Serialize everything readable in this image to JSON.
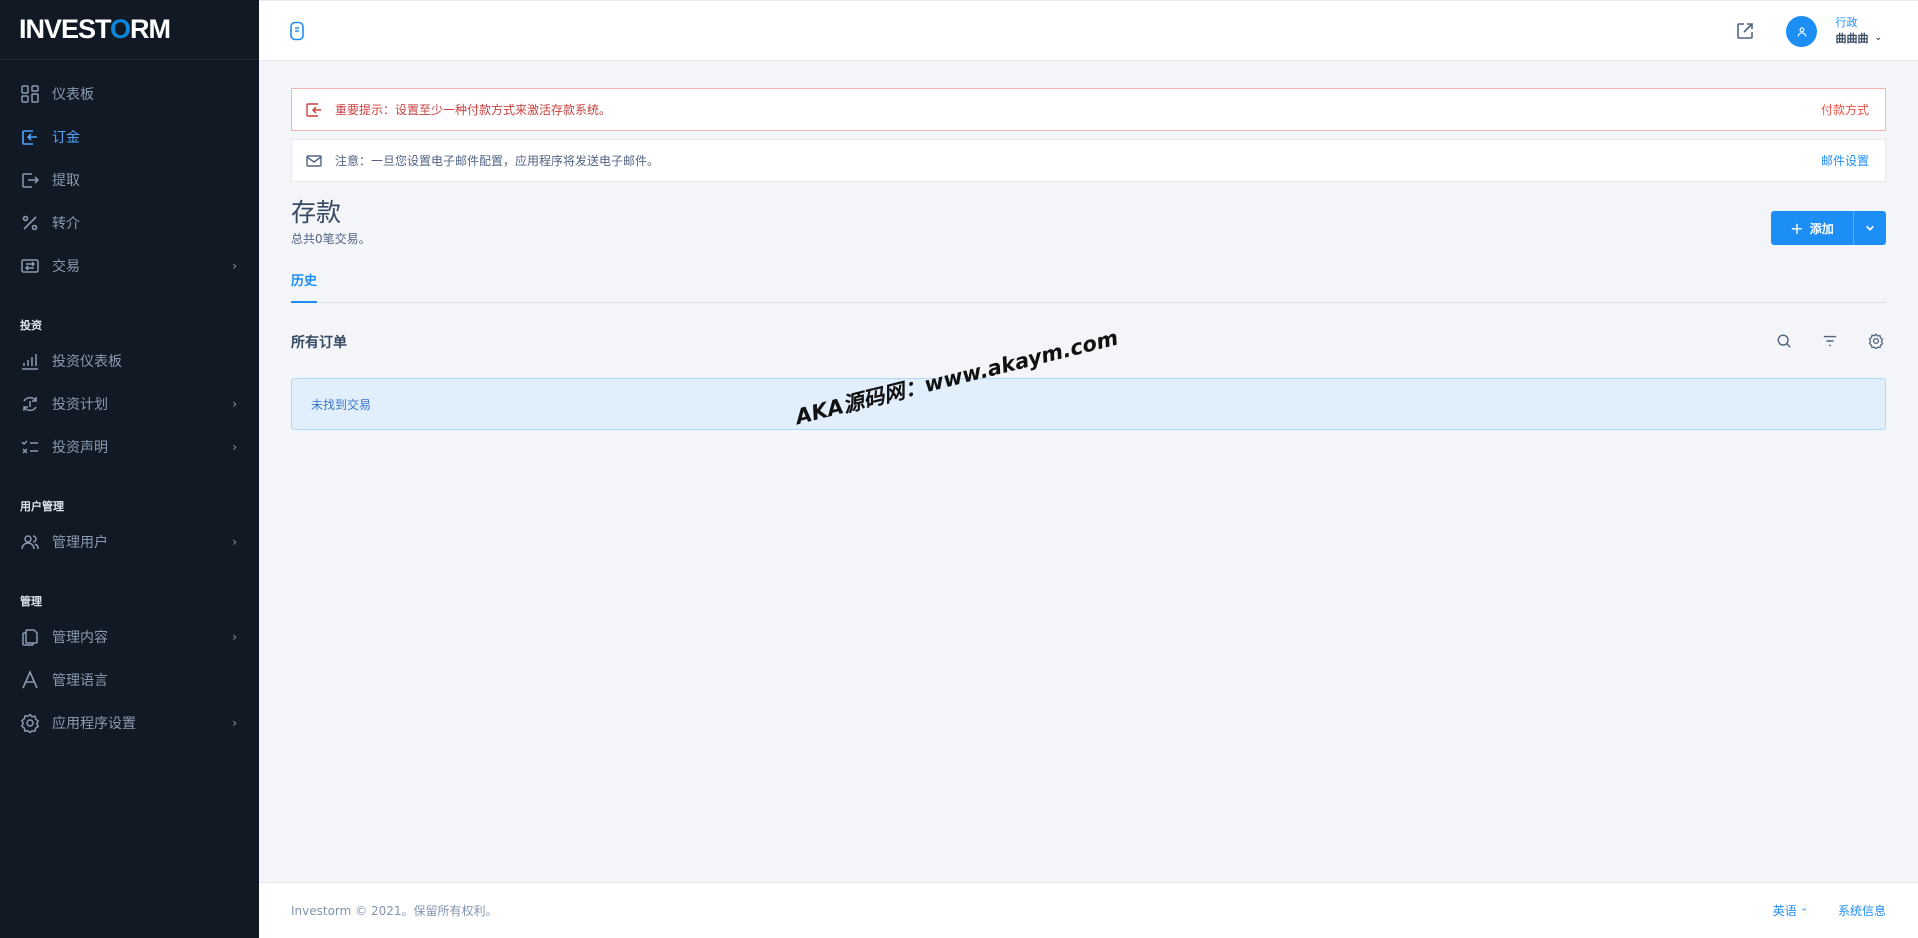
{
  "brand": {
    "name_before": "INVEST",
    "name_o": "O",
    "name_after": "RM"
  },
  "sidebar": {
    "items": [
      {
        "label": "仪表板",
        "icon": "dashboard-icon"
      },
      {
        "label": "订金",
        "icon": "deposit-icon",
        "active": true
      },
      {
        "label": "提取",
        "icon": "withdraw-icon"
      },
      {
        "label": "转介",
        "icon": "percent-icon"
      },
      {
        "label": "交易",
        "icon": "transactions-icon",
        "has_children": true
      }
    ],
    "sections": [
      {
        "heading": "投资",
        "items": [
          {
            "label": "投资仪表板",
            "icon": "chart-bars-icon"
          },
          {
            "label": "投资计划",
            "icon": "refresh-dollar-icon",
            "has_children": true
          },
          {
            "label": "投资声明",
            "icon": "list-check-icon",
            "has_children": true
          }
        ]
      },
      {
        "heading": "用户管理",
        "items": [
          {
            "label": "管理用户",
            "icon": "users-icon",
            "has_children": true
          }
        ]
      },
      {
        "heading": "管理",
        "items": [
          {
            "label": "管理内容",
            "icon": "files-icon",
            "has_children": true
          },
          {
            "label": "管理语言",
            "icon": "letter-a-icon"
          },
          {
            "label": "应用程序设置",
            "icon": "gear-icon",
            "has_children": true
          }
        ]
      }
    ]
  },
  "header": {
    "user_role": "行政",
    "user_name": "曲曲曲"
  },
  "alerts": {
    "danger": {
      "text": "重要提示：设置至少一种付款方式来激活存款系统。",
      "link": "付款方式"
    },
    "info": {
      "text": "注意：一旦您设置电子邮件配置，应用程序将发送电子邮件。",
      "link": "邮件设置"
    }
  },
  "page": {
    "title": "存款",
    "subtitle": "总共0笔交易。",
    "add_label": "添加",
    "tab": "历史",
    "list_title": "所有订单",
    "empty_text": "未找到交易"
  },
  "watermark": "AKA源码网：www.akaym.com",
  "footer": {
    "copyright": "Investorm © 2021。保留所有权利。",
    "language": "英语",
    "system_info": "系统信息"
  },
  "colors": {
    "sidebar_bg": "#101924",
    "accent": "#1e8ef7",
    "danger": "#e85347"
  }
}
